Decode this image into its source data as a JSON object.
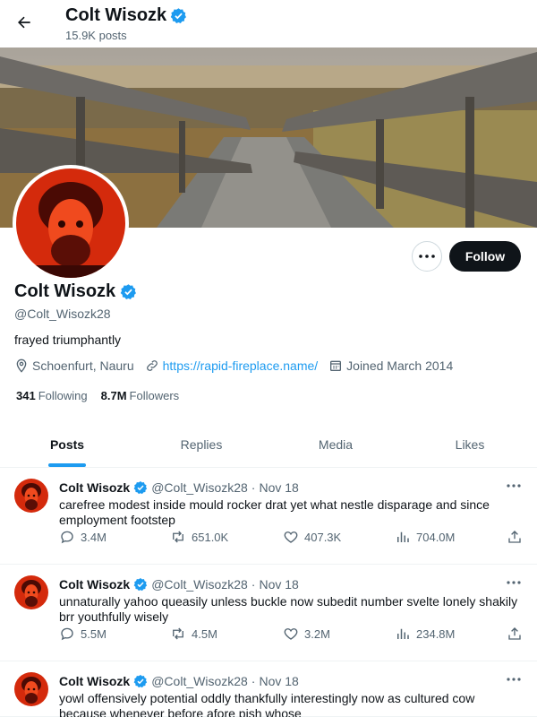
{
  "header": {
    "name": "Colt Wisozk",
    "post_count": "15.9K posts"
  },
  "profile": {
    "name": "Colt Wisozk",
    "handle": "@Colt_Wisozk28",
    "bio": "frayed triumphantly",
    "location": "Schoenfurt, Nauru",
    "website": "https://rapid-fireplace.name/",
    "joined": "Joined March 2014",
    "following_count": "341",
    "following_label": "Following",
    "followers_count": "8.7M",
    "followers_label": "Followers",
    "follow_label": "Follow"
  },
  "tabs": [
    {
      "label": "Posts",
      "active": true
    },
    {
      "label": "Replies",
      "active": false
    },
    {
      "label": "Media",
      "active": false
    },
    {
      "label": "Likes",
      "active": false
    }
  ],
  "tweets": [
    {
      "name": "Colt Wisozk",
      "handle": "@Colt_Wisozk28",
      "separator": "·",
      "date": "Nov 18",
      "text": "carefree modest inside mould rocker drat yet what nestle disparage and since employment footstep",
      "replies": "3.4M",
      "reposts": "651.0K",
      "likes": "407.3K",
      "views": "704.0M"
    },
    {
      "name": "Colt Wisozk",
      "handle": "@Colt_Wisozk28",
      "separator": "·",
      "date": "Nov 18",
      "text": "unnaturally yahoo queasily unless buckle now subedit number svelte lonely shakily brr youthfully wisely",
      "replies": "5.5M",
      "reposts": "4.5M",
      "likes": "3.2M",
      "views": "234.8M"
    },
    {
      "name": "Colt Wisozk",
      "handle": "@Colt_Wisozk28",
      "separator": "·",
      "date": "Nov 18",
      "text": "yowl offensively potential oddly thankfully interestingly now as cultured cow because whenever before afore pish whose",
      "replies": "",
      "reposts": "",
      "likes": "",
      "views": ""
    }
  ],
  "colors": {
    "accent": "#1d9bf0",
    "text": "#0f1419",
    "muted": "#536471",
    "follow_bg": "#0f1419"
  }
}
